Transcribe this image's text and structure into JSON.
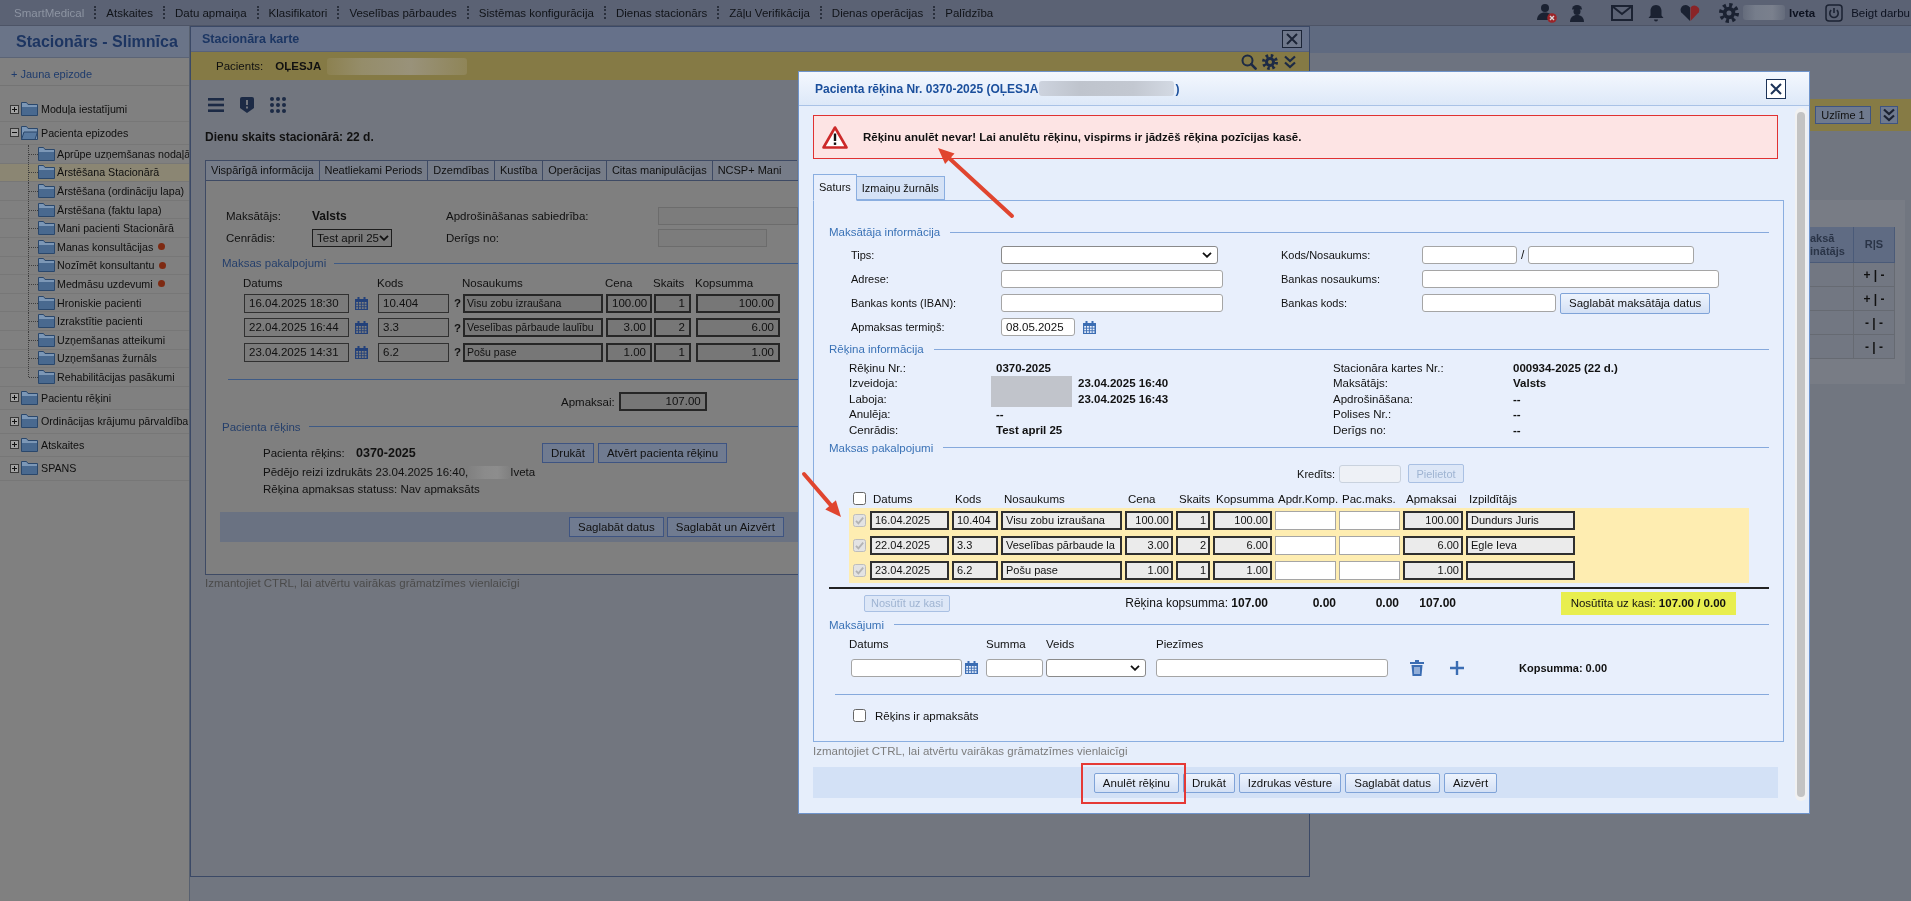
{
  "menu_bar": {
    "items": [
      {
        "label": "SmartMedical",
        "disabled": true
      },
      {
        "label": "Atskaites",
        "disabled": false
      },
      {
        "label": "Datu apmaiņa",
        "disabled": false
      },
      {
        "label": "Klasifikatori",
        "disabled": false
      },
      {
        "label": "Veselības pārbaudes",
        "disabled": false
      },
      {
        "label": "Sistēmas konfigurācija",
        "disabled": false
      },
      {
        "label": "Dienas stacionārs",
        "disabled": false
      },
      {
        "label": "Zāļu Verifikācija",
        "disabled": false
      },
      {
        "label": "Dienas operācijas",
        "disabled": false
      },
      {
        "label": "Palīdzība",
        "disabled": false
      }
    ],
    "user_name": "Iveta",
    "logout": "Beigt darbu"
  },
  "sidebar": {
    "title": "Stacionārs - Slimnīca",
    "new_episode": "+ Jauna epizode",
    "tree": [
      {
        "label": "Moduļa iestatījumi",
        "expanded": false,
        "selected": false,
        "alert": false
      },
      {
        "label": "Pacienta epizodes",
        "expanded": true,
        "selected": false,
        "alert": false,
        "children": [
          {
            "label": "Aprūpe uzņemšanas nodaļā",
            "selected": false,
            "alert": false
          },
          {
            "label": "Ārstēšana Stacionārā",
            "selected": true,
            "alert": false
          },
          {
            "label": "Ārstēšana (ordināciju lapa)",
            "selected": false,
            "alert": false
          },
          {
            "label": "Ārstēšana (faktu lapa)",
            "selected": false,
            "alert": false
          },
          {
            "label": "Mani pacienti Stacionārā",
            "selected": false,
            "alert": false
          },
          {
            "label": "Manas konsultācijas",
            "selected": false,
            "alert": true
          },
          {
            "label": "Nozīmēt konsultantu",
            "selected": false,
            "alert": true
          },
          {
            "label": "Medmāsu uzdevumi",
            "selected": false,
            "alert": true
          },
          {
            "label": "Hroniskie pacienti",
            "selected": false,
            "alert": false
          },
          {
            "label": "Izrakstītie pacienti",
            "selected": false,
            "alert": false
          },
          {
            "label": "Uzņemšanas atteikumi",
            "selected": false,
            "alert": false
          },
          {
            "label": "Uzņemšanas žurnāls",
            "selected": false,
            "alert": false
          },
          {
            "label": "Rehabilitācijas pasākumi",
            "selected": false,
            "alert": false
          }
        ]
      },
      {
        "label": "Pacientu rēķini",
        "expanded": false,
        "selected": false,
        "alert": false
      },
      {
        "label": "Ordinācijas krājumu pārvaldība",
        "expanded": false,
        "selected": false,
        "alert": false
      },
      {
        "label": "Atskaites",
        "expanded": false,
        "selected": false,
        "alert": false
      },
      {
        "label": "SPANS",
        "expanded": false,
        "selected": false,
        "alert": false
      }
    ]
  },
  "background_panel": {
    "sticker_button": "Uzlīme 1",
    "table": {
      "columns": [
        "aksā\ninātājs",
        "R|S"
      ],
      "rows": [
        {
          "r_s": "+ | -"
        },
        {
          "r_s": "+ | -"
        },
        {
          "r_s": "- | -"
        },
        {
          "r_s": "- | -"
        }
      ]
    }
  },
  "record_window": {
    "title": "Stacionāra karte",
    "patient_label": "Pacients:",
    "patient_name": "OĻESJA",
    "days_in_hospital": "Dienu skaits stacionārā: 22 d.",
    "tabs": [
      {
        "label": "Vispārīgā informācija",
        "selected": false
      },
      {
        "label": "Neatliekami Periods",
        "selected": false
      },
      {
        "label": "Dzemdības",
        "selected": false
      },
      {
        "label": "Kustība",
        "selected": false
      },
      {
        "label": "Operācijas",
        "selected": false
      },
      {
        "label": "Citas manipulācijas",
        "selected": false
      },
      {
        "label": "NCSP+ Mani",
        "selected": false
      }
    ],
    "payer_label": "Maksātājs:",
    "payer": "Valsts",
    "insurer_label": "Apdrošināšanas sabiedrība:",
    "price_list_label": "Cenrādis:",
    "price_list": "Test april 25",
    "valid_from_label": "Derīgs no:",
    "services": {
      "legend": "Maksas pakalpojumi",
      "columns": [
        "Datums",
        "Kods",
        "Nosaukums",
        "Cena",
        "Skaits",
        "Kopsumma"
      ],
      "rows": [
        {
          "date": "16.04.2025 18:30",
          "code": "10.404",
          "hint": "?",
          "name": "Visu zobu izraušana",
          "price": "100.00",
          "quantity": "1",
          "total": "100.00"
        },
        {
          "date": "22.04.2025 16:44",
          "code": "3.3",
          "hint": "?",
          "name": "Veselības pārbaude laulību",
          "price": "3.00",
          "quantity": "2",
          "total": "6.00"
        },
        {
          "date": "23.04.2025 14:31",
          "code": "6.2",
          "hint": "?",
          "name": "Pošu pase",
          "price": "1.00",
          "quantity": "1",
          "total": "1.00"
        }
      ]
    },
    "to_pay_label": "Apmaksai:",
    "to_pay": "107.00",
    "invoice": {
      "legend": "Pacienta rēķins",
      "label": "Pacienta rēķins:",
      "number": "0370-2025",
      "buttons": [
        "Drukāt",
        "Atvērt pacienta rēķinu"
      ],
      "printed": "Pēdējo reizi izdrukāts 23.04.2025 16:40,",
      "printed_by": "Iveta",
      "status": "Rēķina apmaksas statuss: Nav apmaksāts"
    },
    "buttons": [
      "Saglabāt datus",
      "Saglabāt un Aizvērt"
    ],
    "hint": "Izmantojiet CTRL, lai atvērtu vairākas grāmatzīmes vienlaicīgi"
  },
  "invoice_dialog": {
    "title": "Pacienta rēķina Nr. 0370-2025 (OĻESJA",
    "title_end": ")",
    "alert": {
      "kind": "error",
      "message": "Rēķinu anulēt nevar! Lai anulētu rēķinu, vispirms ir jādzēš rēķina pozīcijas kasē.",
      "annotated": true
    },
    "tabs": [
      {
        "label": "Saturs",
        "selected": true
      },
      {
        "label": "Izmaiņu žurnāls",
        "selected": false
      }
    ],
    "payer_section": {
      "legend": "Maksātāja informācija",
      "left": [
        {
          "kind": "select",
          "label": "Tips:"
        },
        {
          "kind": "text",
          "label": "Adrese:"
        },
        {
          "kind": "text",
          "label": "Bankas konts (IBAN):"
        },
        {
          "kind": "date",
          "label": "Apmaksas termiņš:",
          "value": "08.05.2025"
        }
      ],
      "right": [
        {
          "kind": "pair",
          "label": "Kods/Nosaukums:",
          "separator": "/"
        },
        {
          "kind": "wide",
          "label": "Bankas nosaukums:"
        },
        {
          "kind": "button",
          "label": "Bankas kods:",
          "button": "Saglabāt maksātāja datus"
        }
      ]
    },
    "info_section": {
      "legend": "Rēķina informācija",
      "left": [
        {
          "kind": "plain",
          "label": "Rēķinu Nr.:",
          "value": "0370-2025"
        },
        {
          "kind": "person",
          "label": "Izveidoja:",
          "value": "23.04.2025 16:40"
        },
        {
          "kind": "person",
          "label": "Laboja:",
          "value": "23.04.2025 16:43"
        },
        {
          "kind": "plain",
          "label": "Anulēja:",
          "value": "--"
        },
        {
          "kind": "plain",
          "label": "Cenrādis:",
          "value": "Test april 25"
        }
      ],
      "right": [
        {
          "kind": "plain",
          "label": "Stacionāra kartes Nr.:",
          "value": "000934-2025 (22 d.)"
        },
        {
          "kind": "plain",
          "label": "Maksātājs:",
          "value": "Valsts"
        },
        {
          "kind": "plain",
          "label": "Apdrošināšana:",
          "value": "--"
        },
        {
          "kind": "plain",
          "label": "Polises Nr.:",
          "value": "--"
        },
        {
          "kind": "plain",
          "label": "Derīgs no:",
          "value": "--"
        }
      ]
    },
    "services_section": {
      "legend": "Maksas pakalpojumi",
      "credit": {
        "label": "Kredīts:",
        "disabled": true
      },
      "apply_button": {
        "label": "Pielietot",
        "disabled": true
      },
      "select_all": {
        "checked": false
      },
      "columns": [
        "Datums",
        "Kods",
        "Nosaukums",
        "Cena",
        "Skaits",
        "Kopsumma",
        "Apdr.Komp.",
        "Pac.maks.",
        "Apmaksai",
        "Izpildītājs"
      ],
      "rows": [
        {
          "checked": true,
          "disabled": true,
          "date": "16.04.2025",
          "code": "10.404",
          "name": "Visu zobu izraušana",
          "price": "100.00",
          "quantity": "1",
          "total": "100.00",
          "to_pay": "100.00",
          "performer": "Dundurs Juris"
        },
        {
          "checked": true,
          "disabled": true,
          "date": "22.04.2025",
          "code": "3.3",
          "name": "Veselības pārbaude la",
          "price": "3.00",
          "quantity": "2",
          "total": "6.00",
          "to_pay": "6.00",
          "performer": "Egle Ieva"
        },
        {
          "checked": true,
          "disabled": true,
          "date": "23.04.2025",
          "code": "6.2",
          "name": "Pošu pase",
          "price": "1.00",
          "quantity": "1",
          "total": "1.00",
          "to_pay": "1.00"
        }
      ],
      "annotated": true,
      "send_button": {
        "label": "Nosūtīt uz kasi",
        "disabled": true
      },
      "grand_total": "Rēķina kopsumma: **107.00**",
      "insurer_total": "0.00",
      "patient_total": "0.00",
      "to_pay_total": "107.00",
      "sent_to_cashier": "Nosūtīta uz kasi: **107.00 / 0.00**"
    },
    "payments_section": {
      "legend": "Maksājumi",
      "columns": [
        "Datums",
        "Summa",
        "Veids",
        "Piezīmes"
      ],
      "total": "Kopsumma: 0.00"
    },
    "paid": {
      "label": "Rēķins ir apmaksāts",
      "checked": false
    },
    "hint": "Izmantojiet CTRL, lai atvērtu vairākas grāmatzīmes vienlaicīgi",
    "buttons": [
      {
        "label": "Anulēt rēķinu",
        "annotated": true
      },
      {
        "label": "Drukāt",
        "annotated": false
      },
      {
        "label": "Izdrukas vēsture",
        "annotated": false
      },
      {
        "label": "Saglabāt datus",
        "annotated": false
      },
      {
        "label": "Aizvērt",
        "annotated": false
      }
    ]
  }
}
